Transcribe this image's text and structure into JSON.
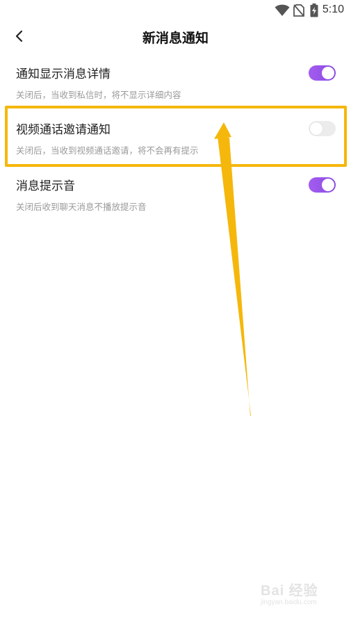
{
  "status_bar": {
    "time": "5:10",
    "icons": [
      "wifi-icon",
      "no-sim-icon",
      "battery-charging-icon"
    ]
  },
  "header": {
    "title": "新消息通知",
    "back_icon": "chevron-left-icon"
  },
  "settings": [
    {
      "title": "通知显示消息详情",
      "description": "关闭后，当收到私信时，将不显示详细内容",
      "enabled": true
    },
    {
      "title": "视频通话邀请通知",
      "description": "关闭后，当收到视频通话邀请，将不会再有提示",
      "enabled": false
    },
    {
      "title": "消息提示音",
      "description": "关闭后收到聊天消息不播放提示音",
      "enabled": true
    }
  ],
  "annotation": {
    "color": "#f5b70b"
  },
  "colors": {
    "toggle_on": "#9b57ec",
    "toggle_off": "#ececec"
  },
  "watermark": {
    "brand": "Bai 经验",
    "sub": "jingyan.baidu.com"
  }
}
